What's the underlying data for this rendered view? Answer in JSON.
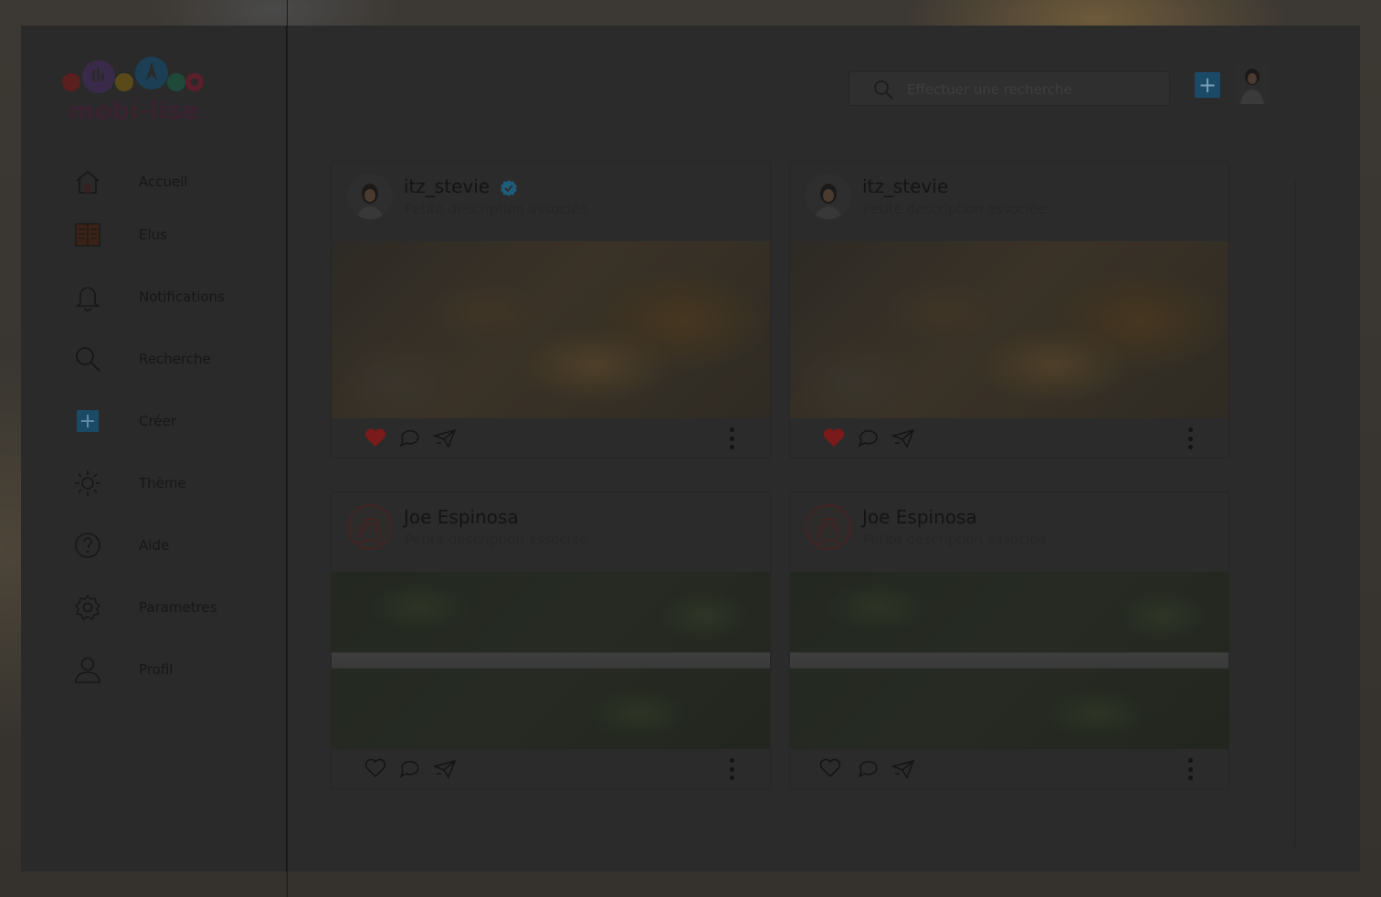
{
  "app": {
    "logo_text": "mobi-lise"
  },
  "sidebar": {
    "items": [
      {
        "label": "Accueil",
        "icon": "home-icon"
      },
      {
        "label": "Elus",
        "icon": "elected-officials-icon"
      },
      {
        "label": "Notifications",
        "icon": "bell-icon"
      },
      {
        "label": "Recherche",
        "icon": "search-icon"
      },
      {
        "label": "Créer",
        "icon": "plus-square-icon"
      },
      {
        "label": "Thème",
        "icon": "sun-icon"
      },
      {
        "label": "Aide",
        "icon": "help-icon"
      },
      {
        "label": "Parametres",
        "icon": "gear-icon"
      },
      {
        "label": "Profil",
        "icon": "user-icon"
      }
    ]
  },
  "topbar": {
    "search_placeholder": "Effectuer une recherche",
    "add_label": "+"
  },
  "posts": [
    {
      "author": "itz_stevie",
      "verified": true,
      "description": "Petite description associée",
      "liked": true,
      "image": "world-map-photo"
    },
    {
      "author": "itz_stevie",
      "verified": false,
      "description": "Petite description associée",
      "liked": true,
      "image": "world-map-photo"
    },
    {
      "author": "Joe Espinosa",
      "verified": false,
      "description": "Petite description associée",
      "liked": false,
      "image": "highway-interchange-photo"
    },
    {
      "author": "Joe Espinosa",
      "verified": false,
      "description": "Petite description associée",
      "liked": false,
      "image": "highway-interchange-photo"
    }
  ],
  "colors": {
    "accent": "#1b4a66",
    "like": "#7a1a1a",
    "verified": "#1f5c7a",
    "overlay": "#2b2b2b"
  }
}
